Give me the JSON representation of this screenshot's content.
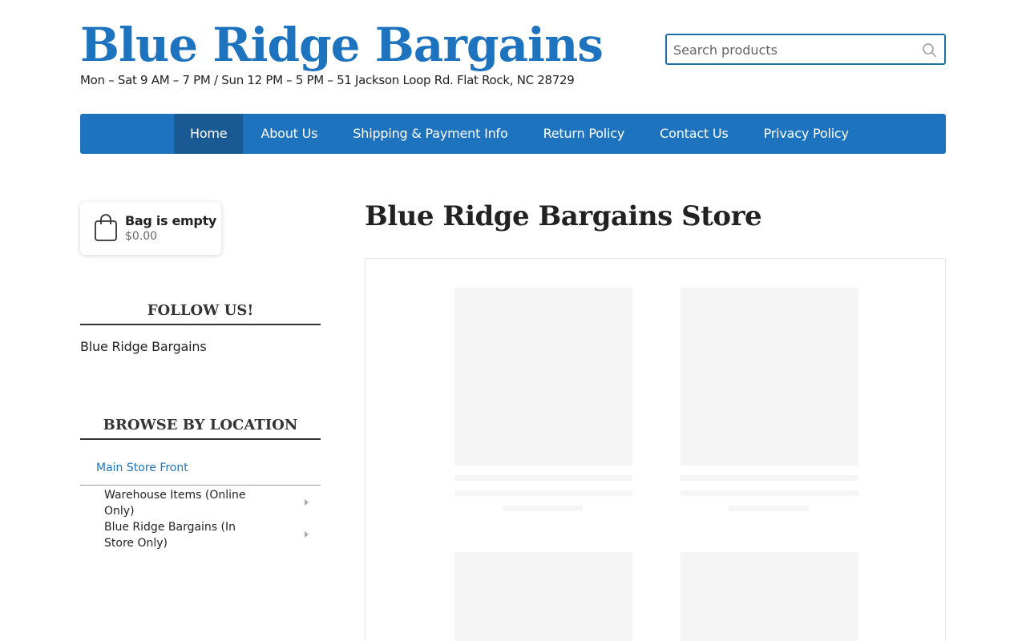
{
  "header": {
    "site_title": "Blue Ridge Bargains",
    "tagline": "Mon – Sat 9 AM – 7 PM / Sun 12 PM – 5 PM – 51 Jackson Loop Rd. Flat Rock, NC 28729",
    "search": {
      "placeholder": "Search products",
      "value": "",
      "icon": "search-icon"
    }
  },
  "nav": {
    "items": [
      {
        "label": "Home",
        "active": true
      },
      {
        "label": "About Us"
      },
      {
        "label": "Shipping & Payment Info"
      },
      {
        "label": "Return Policy"
      },
      {
        "label": "Contact Us"
      },
      {
        "label": "Privacy Policy"
      }
    ]
  },
  "sidebar": {
    "bag": {
      "title": "Bag is empty",
      "total": "$0.00",
      "icon": "shopping-bag-icon"
    },
    "follow": {
      "title": "FOLLOW US!",
      "link": "Blue Ridge Bargains"
    },
    "browse": {
      "title": "BROWSE BY LOCATION",
      "main": "Main Store Front",
      "subcategories": [
        {
          "label": "Warehouse Items (Online Only)"
        },
        {
          "label": "Blue Ridge Bargains (In Store Only)"
        }
      ]
    }
  },
  "main": {
    "heading": "Blue Ridge Bargains Store"
  },
  "colors": {
    "brand": "#1e73be",
    "nav_active": "#1a5a94",
    "placeholder": "#f5f5f5"
  }
}
